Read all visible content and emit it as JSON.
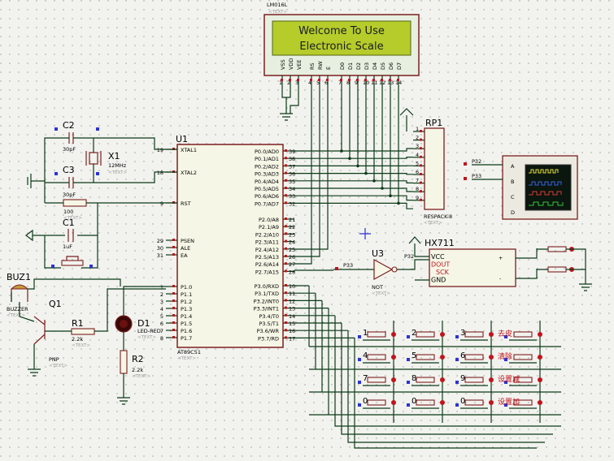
{
  "lcd": {
    "ref": "LM016L",
    "line1": "Welcome To Use",
    "line2": "Electronic Scale",
    "pins": [
      "VSS",
      "VDD",
      "VEE",
      "RS",
      "RW",
      "E",
      "D0",
      "D1",
      "D2",
      "D3",
      "D4",
      "D5",
      "D6",
      "D7"
    ],
    "pinnums": [
      "1",
      "2",
      "3",
      "4",
      "5",
      "6",
      "7",
      "8",
      "9",
      "10",
      "11",
      "12",
      "13",
      "14"
    ]
  },
  "text_tag": "<TEXT>",
  "u1": {
    "ref": "U1",
    "part": "AT89C51",
    "left_pins": [
      [
        "19",
        "XTAL1"
      ],
      [
        "18",
        "XTAL2"
      ],
      [
        "9",
        "RST"
      ],
      [
        "29",
        "PSEN"
      ],
      [
        "30",
        "ALE"
      ],
      [
        "31",
        "EA"
      ],
      [
        "1",
        "P1.0"
      ],
      [
        "2",
        "P1.1"
      ],
      [
        "3",
        "P1.2"
      ],
      [
        "4",
        "P1.3"
      ],
      [
        "5",
        "P1.4"
      ],
      [
        "6",
        "P1.5"
      ],
      [
        "7",
        "P1.6"
      ],
      [
        "8",
        "P1.7"
      ]
    ],
    "right_p0": [
      [
        "39",
        "P0.0/AD0"
      ],
      [
        "38",
        "P0.1/AD1"
      ],
      [
        "37",
        "P0.2/AD2"
      ],
      [
        "36",
        "P0.3/AD3"
      ],
      [
        "35",
        "P0.4/AD4"
      ],
      [
        "34",
        "P0.5/AD5"
      ],
      [
        "33",
        "P0.6/AD6"
      ],
      [
        "32",
        "P0.7/AD7"
      ]
    ],
    "right_p2": [
      [
        "21",
        "P2.0/A8"
      ],
      [
        "22",
        "P2.1/A9"
      ],
      [
        "23",
        "P2.2/A10"
      ],
      [
        "24",
        "P2.3/A11"
      ],
      [
        "25",
        "P2.4/A12"
      ],
      [
        "26",
        "P2.5/A13"
      ],
      [
        "27",
        "P2.6/A14"
      ],
      [
        "28",
        "P2.7/A15"
      ]
    ],
    "right_p3": [
      [
        "10",
        "P3.0/RXD"
      ],
      [
        "11",
        "P3.1/TXD"
      ],
      [
        "12",
        "P3.2/INT0"
      ],
      [
        "13",
        "P3.3/INT1"
      ],
      [
        "14",
        "P3.4/T0"
      ],
      [
        "15",
        "P3.5/T1"
      ],
      [
        "16",
        "P3.6/WR"
      ],
      [
        "17",
        "P3.7/RD"
      ]
    ]
  },
  "c2": {
    "ref": "C2",
    "val": "30pF"
  },
  "c3": {
    "ref": "C3",
    "val": "30pF"
  },
  "x1": {
    "ref": "X1",
    "val": "12MHz"
  },
  "r_rst": {
    "val": "100"
  },
  "c1": {
    "ref": "C1",
    "val": "1uF"
  },
  "buz": {
    "ref": "BUZ1",
    "part": "BUZZER"
  },
  "q1": {
    "ref": "Q1",
    "part": "PNP"
  },
  "r1": {
    "ref": "R1",
    "val": "2.2k"
  },
  "d1": {
    "ref": "D1",
    "part": "LED-RED"
  },
  "r2": {
    "ref": "R2",
    "val": "2.2k"
  },
  "rp1": {
    "ref": "RP1",
    "part": "RESPACK-8",
    "pins": [
      "1",
      "2",
      "3",
      "4",
      "5",
      "6",
      "7",
      "8",
      "9"
    ]
  },
  "scope": {
    "ch": [
      "A",
      "B",
      "C",
      "D"
    ]
  },
  "net": {
    "p32": "P32",
    "p33": "P33"
  },
  "u3": {
    "ref": "U3",
    "part": "NOT"
  },
  "hx": {
    "ref": "HX711",
    "pins": [
      "VCC",
      "DOUT",
      "SCK",
      "GND"
    ],
    "plus": "+",
    "minus": "-"
  },
  "keys": {
    "nums": [
      "1",
      "2",
      "3",
      "4",
      "5",
      "6",
      "7",
      "8",
      "9",
      "0"
    ],
    "cn": [
      "去皮",
      "清除",
      "设置减",
      "设置加"
    ]
  }
}
